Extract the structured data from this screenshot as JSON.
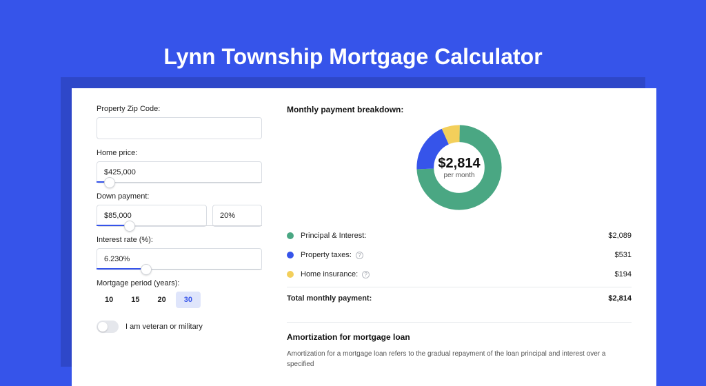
{
  "title": "Lynn Township Mortgage Calculator",
  "form": {
    "zip_label": "Property Zip Code:",
    "zip_value": "",
    "home_price_label": "Home price:",
    "home_price_value": "$425,000",
    "home_price_slider_pct": 8,
    "down_label": "Down payment:",
    "down_value": "$85,000",
    "down_pct_value": "20%",
    "down_slider_pct": 20,
    "rate_label": "Interest rate (%):",
    "rate_value": "6.230%",
    "rate_slider_pct": 30,
    "period_label": "Mortgage period (years):",
    "periods": [
      "10",
      "15",
      "20",
      "30"
    ],
    "period_selected": "30",
    "veteran_label": "I am veteran or military",
    "veteran_on": false
  },
  "breakdown": {
    "title": "Monthly payment breakdown:",
    "total_amount": "$2,814",
    "per_month": "per month",
    "items": [
      {
        "label": "Principal & Interest:",
        "value": "$2,089",
        "color": "green",
        "info": false
      },
      {
        "label": "Property taxes:",
        "value": "$531",
        "color": "blue",
        "info": true
      },
      {
        "label": "Home insurance:",
        "value": "$194",
        "color": "yellow",
        "info": true
      }
    ],
    "total_label": "Total monthly payment:",
    "total_value": "$2,814"
  },
  "amortization": {
    "title": "Amortization for mortgage loan",
    "text": "Amortization for a mortgage loan refers to the gradual repayment of the loan principal and interest over a specified"
  },
  "chart_data": {
    "type": "pie",
    "title": "Monthly payment breakdown",
    "series": [
      {
        "name": "Principal & Interest",
        "value": 2089,
        "color": "#4aa783"
      },
      {
        "name": "Property taxes",
        "value": 531,
        "color": "#3654ea"
      },
      {
        "name": "Home insurance",
        "value": 194,
        "color": "#f3cf5b"
      }
    ],
    "total": 2814,
    "unit": "USD/month"
  }
}
